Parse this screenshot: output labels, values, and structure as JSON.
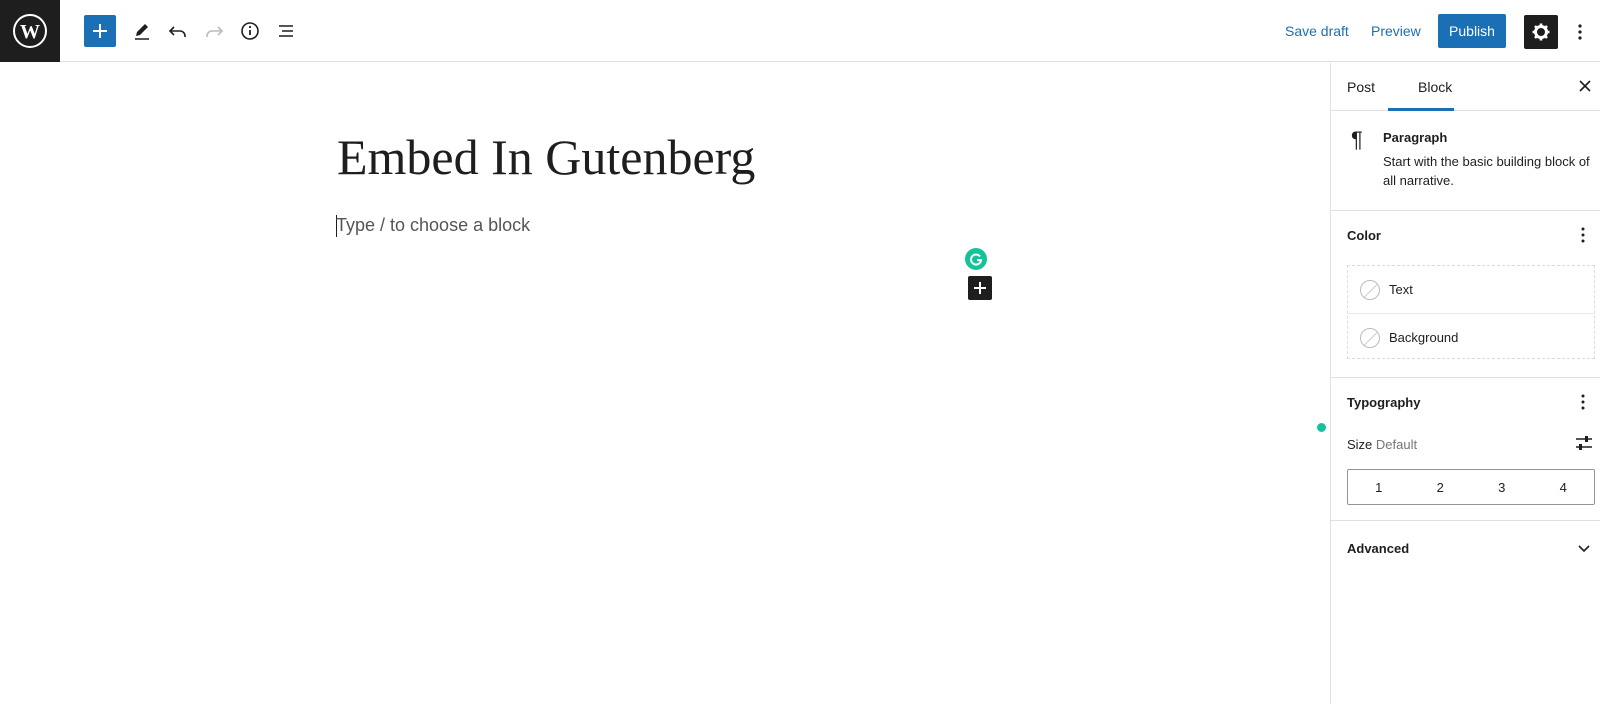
{
  "toolbar": {
    "save_draft": "Save draft",
    "preview": "Preview",
    "publish": "Publish"
  },
  "editor": {
    "title": "Embed In Gutenberg",
    "placeholder": "Type / to choose a block"
  },
  "sidebar": {
    "tabs": [
      "Post",
      "Block"
    ],
    "active_tab": "Block",
    "block": {
      "name": "Paragraph",
      "description": "Start with the basic building block of all narrative."
    },
    "color": {
      "heading": "Color",
      "items": [
        "Text",
        "Background"
      ]
    },
    "typography": {
      "heading": "Typography",
      "size_label": "Size",
      "size_value": "Default",
      "sizes": [
        "1",
        "2",
        "3",
        "4"
      ]
    },
    "advanced": {
      "heading": "Advanced"
    }
  },
  "colors": {
    "accent": "#1a6fb5",
    "dark": "#1e1e1e",
    "grammarly": "#15c39a"
  }
}
